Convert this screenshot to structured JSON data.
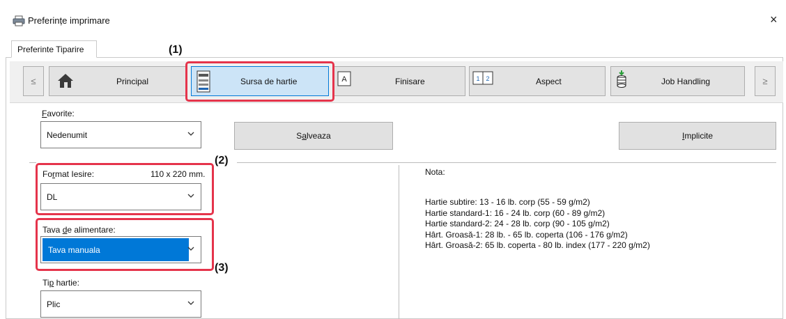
{
  "window": {
    "title": "Preferințe imprimare",
    "close_glyph": "×"
  },
  "page_tab": "Preferinte Tiparire",
  "nav": {
    "prev_arrow": "≤",
    "next_arrow": "≥",
    "tabs": [
      {
        "label": "Principal",
        "icon": "home-icon"
      },
      {
        "label": "Sursa de hartie",
        "icon": "paper-tray-icon",
        "active": true
      },
      {
        "label": "Finisare",
        "icon": "finishing-icon"
      },
      {
        "label": "Aspect",
        "icon": "layout-icon"
      },
      {
        "label": "Job Handling",
        "icon": "job-handling-icon"
      }
    ]
  },
  "favorites": {
    "label_underline": "F",
    "label_rest": "avorite:",
    "value": "Nedenumit",
    "save_underline": "a",
    "save_pre": "S",
    "save_post": "lveaza",
    "defaults_underline": "I",
    "defaults_rest": "mplicite"
  },
  "output_size": {
    "label_pre": "Fo",
    "label_underline": "r",
    "label_post": "mat Iesire:",
    "dimensions": "110 x 220 mm.",
    "value": "DL"
  },
  "paper_tray": {
    "label_pre": "Tava ",
    "label_underline": "d",
    "label_post": "e alimentare:",
    "value": "Tava manuala"
  },
  "paper_type": {
    "label_pre": "Ti",
    "label_underline": "p",
    "label_post": " hartie:",
    "value": "Plic"
  },
  "note": {
    "heading": "Nota:",
    "lines": [
      "Hartie subtire: 13 - 16 lb. corp (55 - 59 g/m2)",
      "Hartie standard-1: 16 - 24 lb. corp (60 - 89 g/m2)",
      "Hartie standard-2: 24 - 28 lb. corp (90 - 105 g/m2)",
      "Hârt. Groasă-1: 28 lb. - 65 lb. coperta (106 - 176 g/m2)",
      "Hârt. Groasă-2: 65 lb. coperta - 80 lb. index (177 - 220 g/m2)"
    ]
  },
  "callouts": {
    "c1": "(1)",
    "c2": "(2)",
    "c3": "(3)"
  },
  "colors": {
    "highlight_box": "#e5344b",
    "selection_blue": "#0078d7",
    "active_tab_bg": "#cce4f7"
  }
}
